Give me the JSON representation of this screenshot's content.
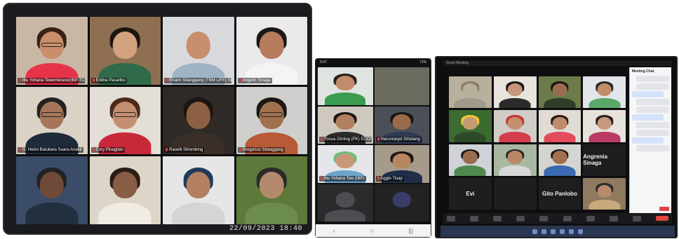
{
  "tablet": {
    "timestamp": "22/09/2023 18:40",
    "participants": [
      {
        "name": "Ibu Yohana Tewernerarer(IBP-TCOSSp)",
        "bg": "#c9b7a6",
        "skin": "#c98e6c",
        "hair": "#3a1f16",
        "shirt": "#e7334a",
        "glasses": true
      },
      {
        "name": "Erikha Pasaribu",
        "bg": "#8f6f51",
        "skin": "#d3a27f",
        "hair": "#1d1512",
        "shirt": "#2f6b4a",
        "glasses": false
      },
      {
        "name": "Efraim Sitanggang (TBM LIFE) SDGp",
        "bg": "#d8d9dc",
        "skin": "#c78f6e",
        "hair": "#d8d9dc",
        "shirt": "#9fb3c4",
        "glasses": false
      },
      {
        "name": "Angelin Sinaga",
        "bg": "#eaeaea",
        "skin": "#b57d5d",
        "hair": "#1d1714",
        "shirt": "#f4f4f4",
        "glasses": false
      },
      {
        "name": "D. Helmi Batubara Suara Anakir",
        "bg": "#dad3c6",
        "skin": "#a57659",
        "hair": "#222",
        "shirt": "#1f2b3a",
        "glasses": true
      },
      {
        "name": "Cory Pinagitan",
        "bg": "#e3ded6",
        "skin": "#c48f70",
        "hair": "#4a2b1c",
        "shirt": "#c8283a",
        "glasses": true
      },
      {
        "name": "Raoelli Sihombing",
        "bg": "#2f2a25",
        "skin": "#8d6044",
        "hair": "#191512",
        "shirt": "#3a2f28",
        "glasses": false
      },
      {
        "name": "Gregorius Sitanggang",
        "bg": "#cfd0cd",
        "skin": "#a1704f",
        "hair": "#1c1714",
        "shirt": "#b85a36",
        "glasses": true
      },
      {
        "name": "",
        "bg": "#3a4c68",
        "skin": "#6f4a38",
        "hair": "#222",
        "shirt": "#22303f",
        "glasses": false
      },
      {
        "name": "",
        "bg": "#ddd6c8",
        "skin": "#8a5e44",
        "hair": "#2a1d17",
        "shirt": "#f0ece4",
        "glasses": false
      },
      {
        "name": "",
        "bg": "#e6e6e6",
        "skin": "#b37f62",
        "hair": "#1f3a5a",
        "shirt": "#d5d5d5",
        "glasses": false
      },
      {
        "name": "",
        "bg": "#5d7a3a",
        "skin": "#b38a6c",
        "hair": "#2a2a2a",
        "shirt": "#6b8c4a",
        "glasses": false
      }
    ]
  },
  "phone": {
    "status_time": "6:47",
    "status_right": "71%",
    "leave_label": "Leave",
    "nav_icons": [
      "‹",
      "○",
      "|||"
    ],
    "participants": [
      {
        "name": "",
        "bg": "#dfe4e1",
        "skin": "#c18c6c",
        "hair": "#2b1e18",
        "shirt": "#3a9c4e"
      },
      {
        "name": "",
        "bg": "#6a6a5e",
        "skin": "#6a6a5e",
        "hair": "#6a6a5e",
        "shirt": "#6a6a5e"
      },
      {
        "name": "Yosua Ginting (PK) ECOSSp",
        "bg": "#cfc9c0",
        "skin": "#b3805f",
        "hair": "#1b1614",
        "shirt": "#2a2a2a"
      },
      {
        "name": "Harunrasyd Sihotang",
        "bg": "#4a4f58",
        "skin": "#9a6a4c",
        "hair": "#1b1614",
        "shirt": "#2f3a56"
      },
      {
        "name": "Ibu Yohana Tew (IBP)",
        "bg": "#e4e6ea",
        "skin": "#c99878",
        "hair": "#6bbf7a",
        "shirt": "#6fa4c9"
      },
      {
        "name": "Aggle Tisap",
        "bg": "#a69a8a",
        "skin": "#b7855f",
        "hair": "#1e1714",
        "shirt": "#1f2d4a"
      },
      {
        "name": "",
        "bg": "#2b2b2d",
        "skin": "#4d4e52",
        "hair": "#2b2b2d",
        "shirt": "#4d4e52"
      },
      {
        "name": "",
        "bg": "#222",
        "skin": "#3b3b6a",
        "hair": "#222",
        "shirt": "#222"
      }
    ]
  },
  "monitor": {
    "window_title": "Zoom Meeting",
    "chat_title": "Meeting Chat",
    "participants": [
      {
        "name": "",
        "bg": "#b7b09d",
        "skin": "#b7b09d",
        "hair": "#8c7c62",
        "shirt": "#9e9a8c",
        "type": "video"
      },
      {
        "name": "",
        "bg": "#e8e4dc",
        "skin": "#c6957a",
        "hair": "#1f1714",
        "shirt": "#2b2b2b",
        "type": "video"
      },
      {
        "name": "",
        "bg": "#6d7a49",
        "skin": "#9a6c4f",
        "hair": "#1a1614",
        "shirt": "#2f3c2a",
        "type": "video"
      },
      {
        "name": "",
        "bg": "#e2e6ea",
        "skin": "#c18d6b",
        "hair": "#2a2a2a",
        "shirt": "#5ba86b",
        "type": "video"
      },
      {
        "name": "",
        "bg": "#3c6b2f",
        "skin": "#c29a73",
        "hair": "#f0c53a",
        "shirt": "#2f4a2a",
        "type": "video"
      },
      {
        "name": "",
        "bg": "#d0ccc6",
        "skin": "#c4906e",
        "hair": "#c93535",
        "shirt": "#d43d4a",
        "type": "video"
      },
      {
        "name": "",
        "bg": "#e0dcd4",
        "skin": "#bf8b6a",
        "hair": "#2a1d17",
        "shirt": "#e24b5b",
        "type": "video"
      },
      {
        "name": "",
        "bg": "#e7e3dc",
        "skin": "#c79a7d",
        "hair": "#2a1f1b",
        "shirt": "#b83b63",
        "type": "video"
      },
      {
        "name": "",
        "bg": "#cfd2d6",
        "skin": "#9c6c4e",
        "hair": "#1b1714",
        "shirt": "#4e8a4e",
        "type": "video"
      },
      {
        "name": "",
        "bg": "#a7b7a0",
        "skin": "#b98866",
        "hair": "#2a2a2a",
        "shirt": "#d8d8d8",
        "type": "video"
      },
      {
        "name": "",
        "bg": "#d4d5d0",
        "skin": "#a1704f",
        "hair": "#1b1714",
        "shirt": "#3a6ab0",
        "type": "video"
      },
      {
        "name": "Angrenia Sinaga",
        "type": "name"
      },
      {
        "name": "Evi",
        "type": "name"
      },
      {
        "name": "",
        "bg": "#1e1e20",
        "skin": "#1e1e20",
        "hair": "#1e1e20",
        "shirt": "#1e1e20",
        "type": "video"
      },
      {
        "name": "Gito Panlobo",
        "type": "name"
      },
      {
        "name": "",
        "bg": "#8f7a5f",
        "skin": "#b88b6a",
        "hair": "#2a2a2a",
        "shirt": "#c9a97c",
        "type": "video"
      }
    ]
  }
}
